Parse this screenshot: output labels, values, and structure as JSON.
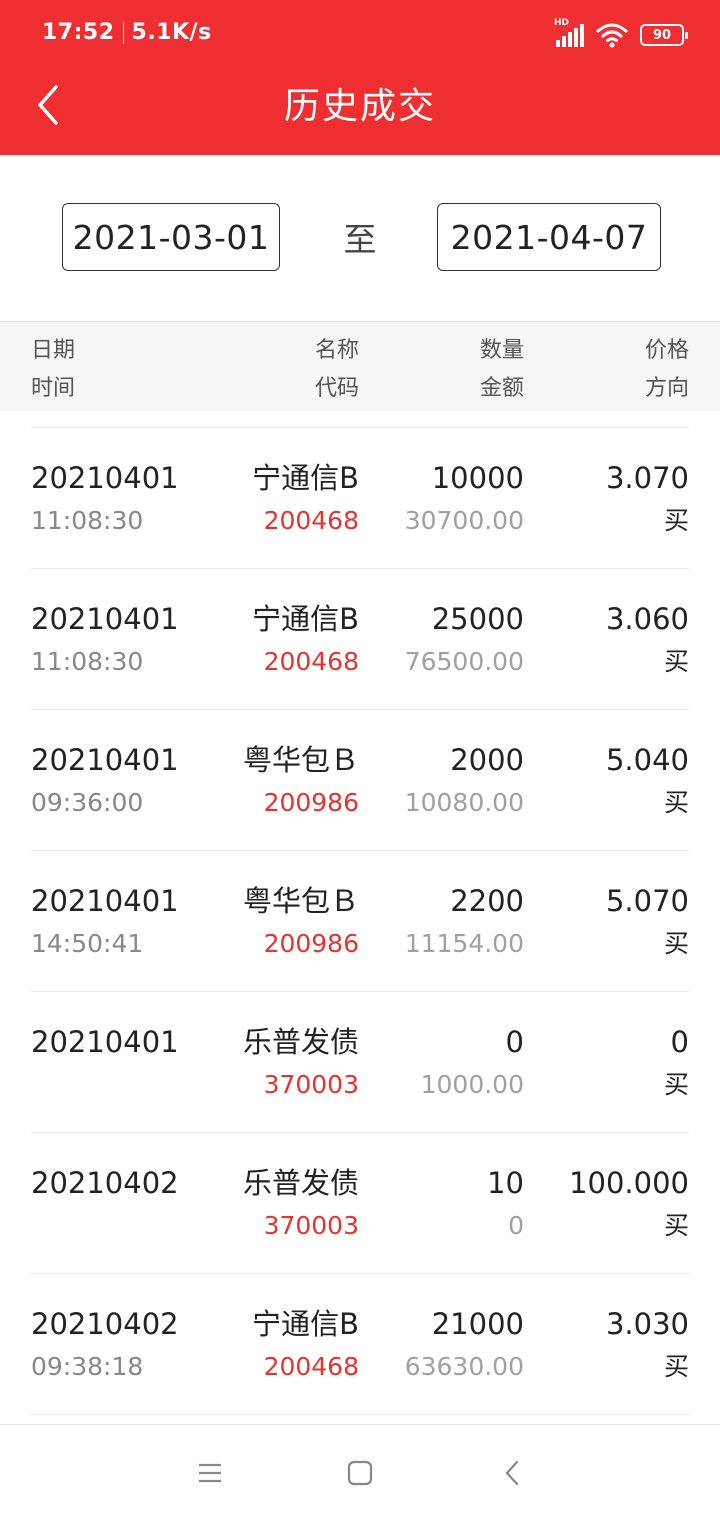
{
  "status_bar": {
    "time": "17:52",
    "network_speed": "5.1K/s",
    "signal_tag": "HD",
    "battery_level": "90"
  },
  "header": {
    "title": "历史成交"
  },
  "date_range": {
    "start": "2021-03-01",
    "separator": "至",
    "end": "2021-04-07"
  },
  "columns": {
    "date": "日期",
    "time": "时间",
    "name": "名称",
    "code": "代码",
    "quantity": "数量",
    "amount": "金额",
    "price": "价格",
    "direction": "方向"
  },
  "trades": [
    {
      "date": "20210401",
      "time": "11:08:30",
      "name": "宁通信B",
      "code": "200468",
      "quantity": "10000",
      "amount": "30700.00",
      "price": "3.070",
      "direction": "买"
    },
    {
      "date": "20210401",
      "time": "11:08:30",
      "name": "宁通信B",
      "code": "200468",
      "quantity": "25000",
      "amount": "76500.00",
      "price": "3.060",
      "direction": "买"
    },
    {
      "date": "20210401",
      "time": "09:36:00",
      "name": "粤华包Ｂ",
      "code": "200986",
      "quantity": "2000",
      "amount": "10080.00",
      "price": "5.040",
      "direction": "买"
    },
    {
      "date": "20210401",
      "time": "14:50:41",
      "name": "粤华包Ｂ",
      "code": "200986",
      "quantity": "2200",
      "amount": "11154.00",
      "price": "5.070",
      "direction": "买"
    },
    {
      "date": "20210401",
      "time": "",
      "name": "乐普发债",
      "code": "370003",
      "quantity": "0",
      "amount": "1000.00",
      "price": "0",
      "direction": "买"
    },
    {
      "date": "20210402",
      "time": "",
      "name": "乐普发债",
      "code": "370003",
      "quantity": "10",
      "amount": "0",
      "price": "100.000",
      "direction": "买"
    },
    {
      "date": "20210402",
      "time": "09:38:18",
      "name": "宁通信B",
      "code": "200468",
      "quantity": "21000",
      "amount": "63630.00",
      "price": "3.030",
      "direction": "买"
    }
  ],
  "colors": {
    "brand_red": "#ee2e30",
    "code_red": "#e8322f",
    "muted_gray": "#888888"
  },
  "icons": {
    "back": "chevron-left-icon",
    "signal": "signal-icon",
    "wifi": "wifi-icon",
    "battery": "battery-icon",
    "nav_menu": "menu-icon",
    "nav_home": "home-square-icon",
    "nav_back": "back-triangle-icon"
  }
}
